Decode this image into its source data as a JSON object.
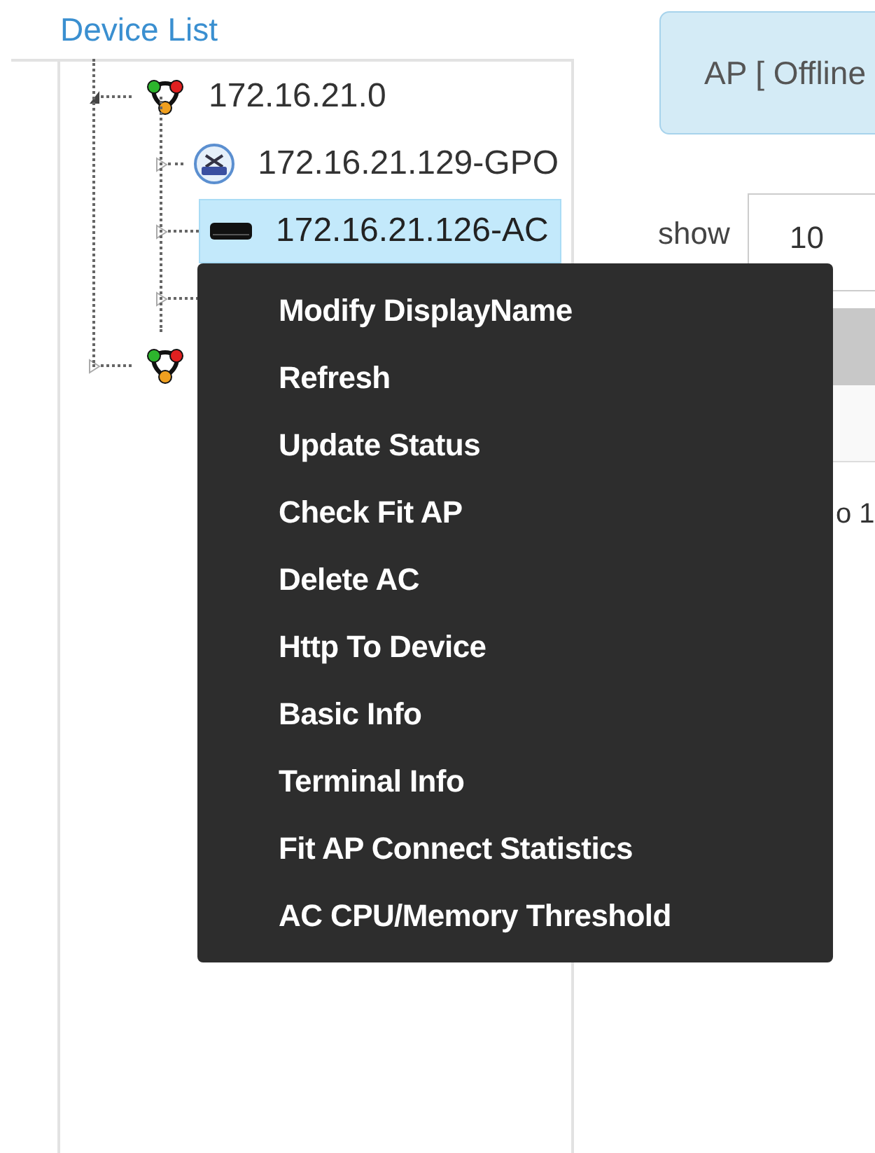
{
  "device_list": {
    "title": "Device List",
    "tree": [
      {
        "kind": "network",
        "label": "172.16.21.0",
        "expanded": true,
        "selected": false,
        "children": [
          {
            "kind": "gpon",
            "label": "172.16.21.129-GPO",
            "expanded": false,
            "selected": false
          },
          {
            "kind": "controller",
            "label": "172.16.21.126-AC",
            "expanded": false,
            "selected": true
          },
          {
            "expanded": false
          }
        ]
      },
      {
        "kind": "network",
        "expanded": false,
        "selected": false
      }
    ]
  },
  "main": {
    "status_button": "AP [ Offline",
    "show_label": "show",
    "page_size": "10",
    "info_text": "o 1"
  },
  "context_menu": {
    "items": [
      "Modify DisplayName",
      "Refresh",
      "Update Status",
      "Check Fit AP",
      "Delete AC",
      "Http To Device",
      "Basic Info",
      "Terminal Info",
      "Fit AP Connect Statistics",
      "AC CPU/Memory Threshold"
    ]
  }
}
